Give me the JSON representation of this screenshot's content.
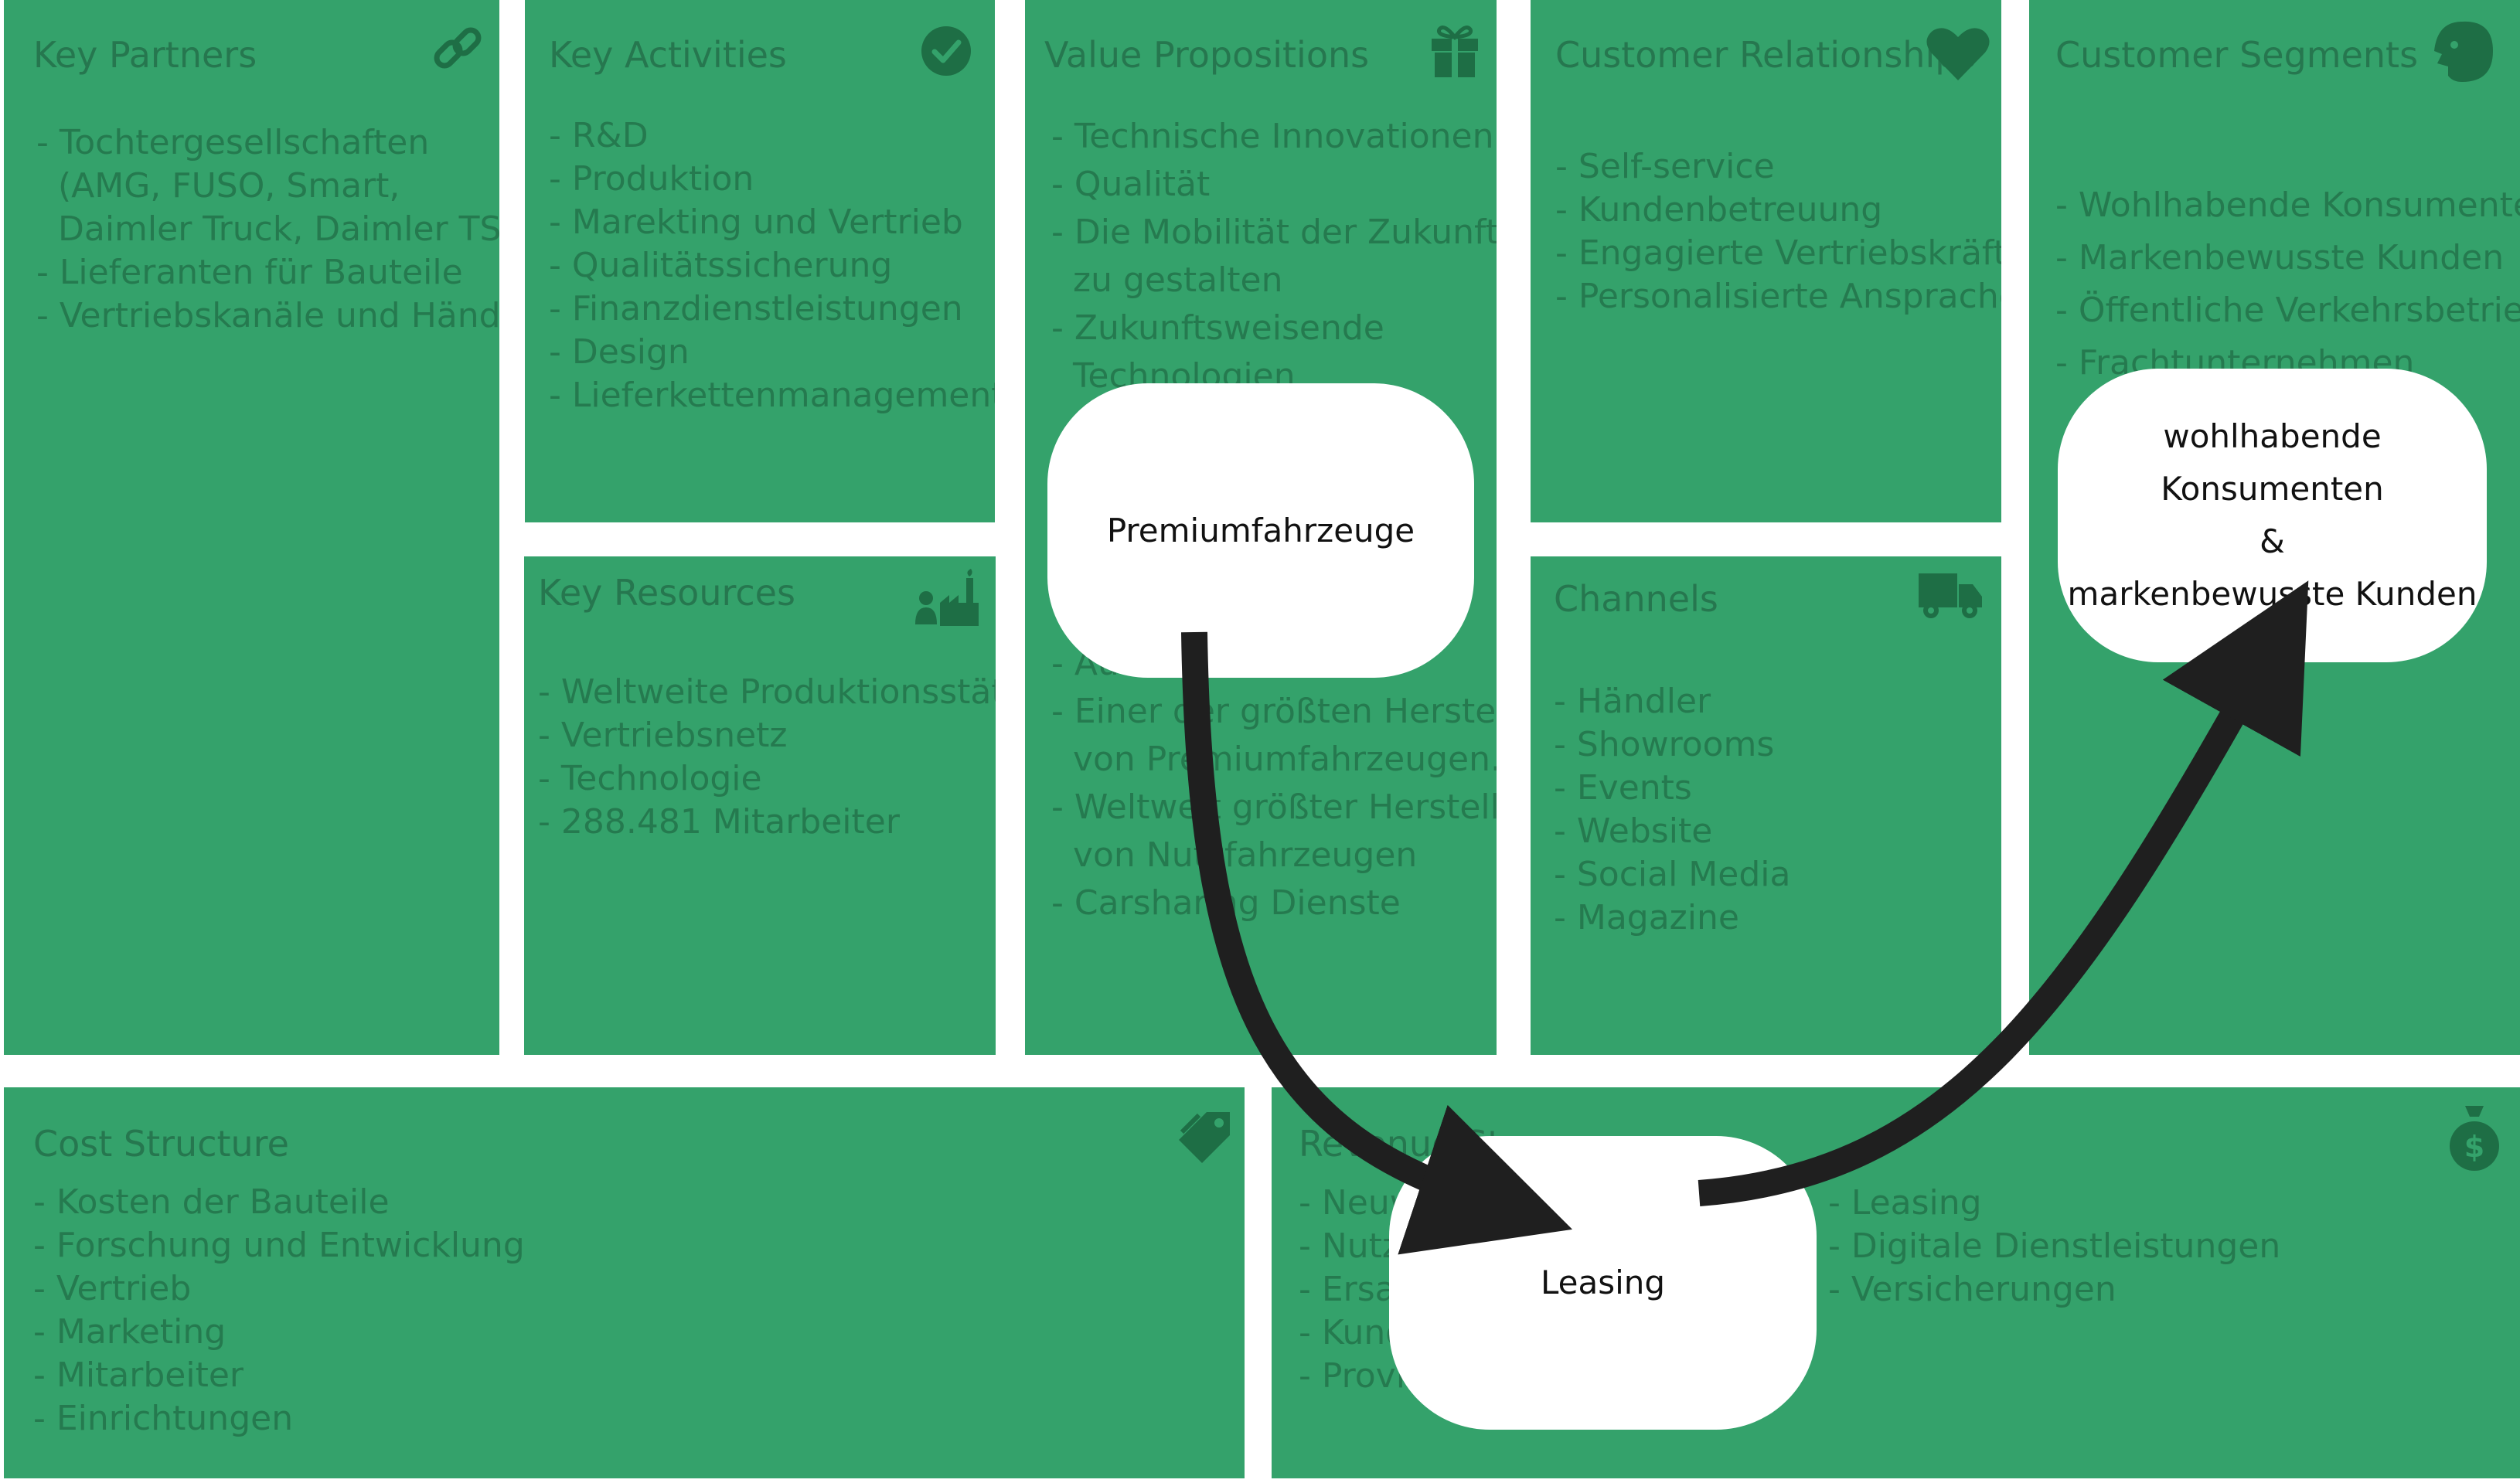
{
  "canvas": {
    "key_partners": {
      "title": "Key Partners",
      "icon": "link-icon",
      "items": [
        "- Tochtergesellschaften",
        "  (AMG, FUSO, Smart,",
        "  Daimler Truck, Daimler TSS...)",
        "- Lieferanten für Bauteile",
        "- Vertriebskanäle und Händler"
      ]
    },
    "key_activities": {
      "title": "Key Activities",
      "icon": "check-circle-icon",
      "items": [
        "- R&D",
        "- Produktion",
        "- Marekting und Vertrieb",
        "- Qualitätssicherung",
        "- Finanzdienstleistungen",
        "- Design",
        "- Lieferkettenmanagement"
      ]
    },
    "key_resources": {
      "title": "Key Resources",
      "icon": "factory-worker-icon",
      "items": [
        "- Weltweite Produktionsstätten",
        "- Vertriebsnetz",
        "- Technologie",
        "- 288.481 Mitarbeiter"
      ]
    },
    "value_propositions": {
      "title": "Value Propositions",
      "icon": "gift-icon",
      "items_top": [
        "- Technische Innovationen",
        "- Qualität",
        "- Die Mobilität der Zukunft",
        "  zu gestalten",
        "- Zukunftsweisende",
        "  Technologien"
      ],
      "items_bottom": [
        "- Auto",
        "- Einer der größten Hersteller",
        "  von Premiumfahrzeugen.",
        "- Weltweit größter Hersteller",
        "  von Nutzfahrzeugen",
        "- Carsharing Dienste"
      ]
    },
    "customer_relationships": {
      "title": "Customer Relationships",
      "icon": "heart-icon",
      "items": [
        "- Self-service",
        "- Kundenbetreuung",
        "- Engagierte Vertriebskräfte",
        "- Personalisierte Ansprache"
      ]
    },
    "channels": {
      "title": "Channels",
      "icon": "truck-icon",
      "items": [
        "- Händler",
        "- Showrooms",
        "- Events",
        "- Website",
        "- Social Media",
        "- Magazine"
      ]
    },
    "customer_segments": {
      "title": "Customer Segments",
      "icon": "face-profile-icon",
      "items": [
        "- Wohlhabende Konsumenten",
        "- Markenbewusste Kunden",
        "- Öffentliche Verkehrsbetriebe",
        "- Frachtunternehmen"
      ]
    },
    "cost_structure": {
      "title": "Cost Structure",
      "icon": "price-tag-icon",
      "items": [
        "- Kosten der Bauteile",
        "- Forschung und Entwicklung",
        "- Vertrieb",
        "- Marketing",
        "- Mitarbeiter",
        "- Einrichtungen"
      ]
    },
    "revenue_streams": {
      "title": "Revenue Streams",
      "icon": "money-bag-icon",
      "items_left": [
        "- Neuwagen",
        "- Nutzfahrzeuge",
        "- Ersatzteile",
        "- Kundendienst",
        "- Provisionen"
      ],
      "items_right": [
        "- Leasing",
        "- Digitale Dienstleistungen",
        "- Versicherungen"
      ]
    }
  },
  "overlay": {
    "premium": "Premiumfahrzeuge",
    "leasing": "Leasing",
    "customers": "wohlhabende\nKonsumenten\n&\nmarkenbewusste Kunden"
  },
  "colors": {
    "block": "#34a26b",
    "text": "#267a50",
    "icon": "#1e6e45",
    "arrow": "#1f1f1f",
    "bubble": "#ffffff"
  }
}
